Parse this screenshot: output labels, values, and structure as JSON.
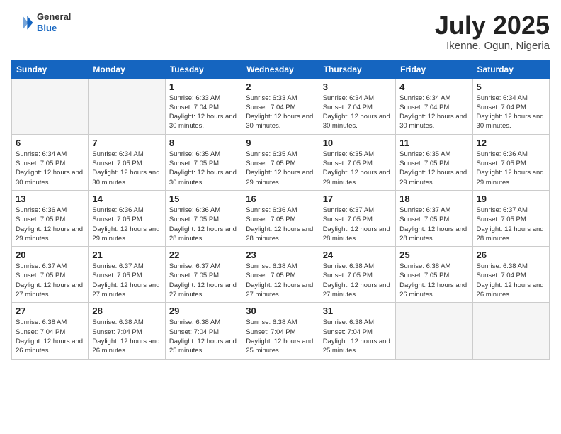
{
  "header": {
    "logo_general": "General",
    "logo_blue": "Blue",
    "title": "July 2025",
    "location": "Ikenne, Ogun, Nigeria"
  },
  "weekdays": [
    "Sunday",
    "Monday",
    "Tuesday",
    "Wednesday",
    "Thursday",
    "Friday",
    "Saturday"
  ],
  "weeks": [
    [
      {
        "day": "",
        "empty": true
      },
      {
        "day": "",
        "empty": true
      },
      {
        "day": "1",
        "sunrise": "6:33 AM",
        "sunset": "7:04 PM",
        "daylight": "12 hours and 30 minutes."
      },
      {
        "day": "2",
        "sunrise": "6:33 AM",
        "sunset": "7:04 PM",
        "daylight": "12 hours and 30 minutes."
      },
      {
        "day": "3",
        "sunrise": "6:34 AM",
        "sunset": "7:04 PM",
        "daylight": "12 hours and 30 minutes."
      },
      {
        "day": "4",
        "sunrise": "6:34 AM",
        "sunset": "7:04 PM",
        "daylight": "12 hours and 30 minutes."
      },
      {
        "day": "5",
        "sunrise": "6:34 AM",
        "sunset": "7:04 PM",
        "daylight": "12 hours and 30 minutes."
      }
    ],
    [
      {
        "day": "6",
        "sunrise": "6:34 AM",
        "sunset": "7:05 PM",
        "daylight": "12 hours and 30 minutes."
      },
      {
        "day": "7",
        "sunrise": "6:34 AM",
        "sunset": "7:05 PM",
        "daylight": "12 hours and 30 minutes."
      },
      {
        "day": "8",
        "sunrise": "6:35 AM",
        "sunset": "7:05 PM",
        "daylight": "12 hours and 30 minutes."
      },
      {
        "day": "9",
        "sunrise": "6:35 AM",
        "sunset": "7:05 PM",
        "daylight": "12 hours and 29 minutes."
      },
      {
        "day": "10",
        "sunrise": "6:35 AM",
        "sunset": "7:05 PM",
        "daylight": "12 hours and 29 minutes."
      },
      {
        "day": "11",
        "sunrise": "6:35 AM",
        "sunset": "7:05 PM",
        "daylight": "12 hours and 29 minutes."
      },
      {
        "day": "12",
        "sunrise": "6:36 AM",
        "sunset": "7:05 PM",
        "daylight": "12 hours and 29 minutes."
      }
    ],
    [
      {
        "day": "13",
        "sunrise": "6:36 AM",
        "sunset": "7:05 PM",
        "daylight": "12 hours and 29 minutes."
      },
      {
        "day": "14",
        "sunrise": "6:36 AM",
        "sunset": "7:05 PM",
        "daylight": "12 hours and 29 minutes."
      },
      {
        "day": "15",
        "sunrise": "6:36 AM",
        "sunset": "7:05 PM",
        "daylight": "12 hours and 28 minutes."
      },
      {
        "day": "16",
        "sunrise": "6:36 AM",
        "sunset": "7:05 PM",
        "daylight": "12 hours and 28 minutes."
      },
      {
        "day": "17",
        "sunrise": "6:37 AM",
        "sunset": "7:05 PM",
        "daylight": "12 hours and 28 minutes."
      },
      {
        "day": "18",
        "sunrise": "6:37 AM",
        "sunset": "7:05 PM",
        "daylight": "12 hours and 28 minutes."
      },
      {
        "day": "19",
        "sunrise": "6:37 AM",
        "sunset": "7:05 PM",
        "daylight": "12 hours and 28 minutes."
      }
    ],
    [
      {
        "day": "20",
        "sunrise": "6:37 AM",
        "sunset": "7:05 PM",
        "daylight": "12 hours and 27 minutes."
      },
      {
        "day": "21",
        "sunrise": "6:37 AM",
        "sunset": "7:05 PM",
        "daylight": "12 hours and 27 minutes."
      },
      {
        "day": "22",
        "sunrise": "6:37 AM",
        "sunset": "7:05 PM",
        "daylight": "12 hours and 27 minutes."
      },
      {
        "day": "23",
        "sunrise": "6:38 AM",
        "sunset": "7:05 PM",
        "daylight": "12 hours and 27 minutes."
      },
      {
        "day": "24",
        "sunrise": "6:38 AM",
        "sunset": "7:05 PM",
        "daylight": "12 hours and 27 minutes."
      },
      {
        "day": "25",
        "sunrise": "6:38 AM",
        "sunset": "7:05 PM",
        "daylight": "12 hours and 26 minutes."
      },
      {
        "day": "26",
        "sunrise": "6:38 AM",
        "sunset": "7:04 PM",
        "daylight": "12 hours and 26 minutes."
      }
    ],
    [
      {
        "day": "27",
        "sunrise": "6:38 AM",
        "sunset": "7:04 PM",
        "daylight": "12 hours and 26 minutes."
      },
      {
        "day": "28",
        "sunrise": "6:38 AM",
        "sunset": "7:04 PM",
        "daylight": "12 hours and 26 minutes."
      },
      {
        "day": "29",
        "sunrise": "6:38 AM",
        "sunset": "7:04 PM",
        "daylight": "12 hours and 25 minutes."
      },
      {
        "day": "30",
        "sunrise": "6:38 AM",
        "sunset": "7:04 PM",
        "daylight": "12 hours and 25 minutes."
      },
      {
        "day": "31",
        "sunrise": "6:38 AM",
        "sunset": "7:04 PM",
        "daylight": "12 hours and 25 minutes."
      },
      {
        "day": "",
        "empty": true
      },
      {
        "day": "",
        "empty": true
      }
    ]
  ]
}
